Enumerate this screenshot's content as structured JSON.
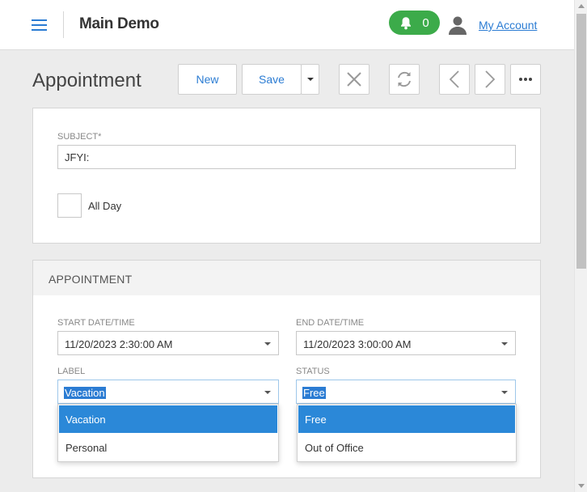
{
  "header": {
    "app_title": "Main Demo",
    "notification_count": "0",
    "account_link": "My Account"
  },
  "toolbar": {
    "page_title": "Appointment",
    "new_label": "New",
    "save_label": "Save"
  },
  "form": {
    "subject_label": "SUBJECT*",
    "subject_value": "JFYI:",
    "all_day_label": "All Day"
  },
  "appointment_section": {
    "title": "APPOINTMENT",
    "start_label": "START DATE/TIME",
    "start_value": "11/20/2023 2:30:00 AM",
    "end_label": "END DATE/TIME",
    "end_value": "11/20/2023 3:00:00 AM",
    "label_label": "LABEL",
    "label_value": "Vacation",
    "status_label": "STATUS",
    "status_value": "Free",
    "label_options": [
      "Vacation",
      "Personal"
    ],
    "status_options": [
      "Free",
      "Out of Office"
    ]
  },
  "colors": {
    "accent": "#2b7cd3",
    "notification": "#3cab4a",
    "selected_item": "#2b88d8"
  },
  "icons": [
    "hamburger-icon",
    "bell-icon",
    "user-icon",
    "chevron-down-icon",
    "close-icon",
    "refresh-icon",
    "chevron-left-icon",
    "chevron-right-icon",
    "more-icon"
  ]
}
